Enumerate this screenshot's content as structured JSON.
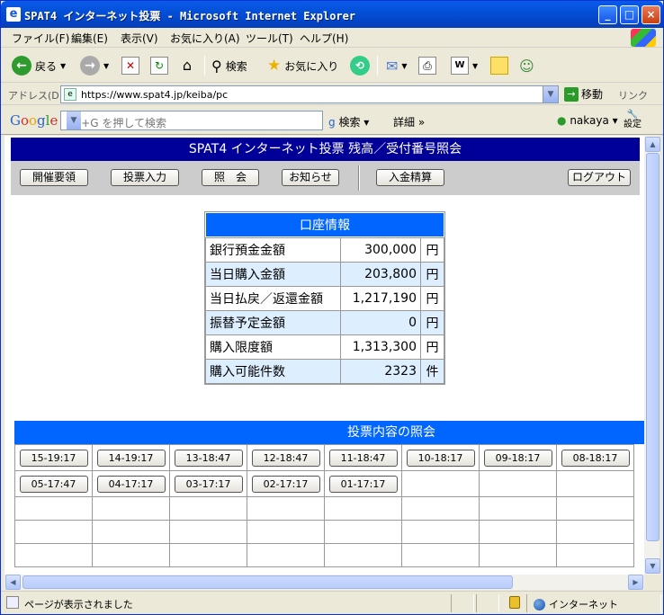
{
  "window": {
    "title": "SPAT4 インターネット投票 - Microsoft Internet Explorer"
  },
  "menu": [
    "ファイル(F)",
    "編集(E)",
    "表示(V)",
    "お気に入り(A)",
    "ツール(T)",
    "ヘルプ(H)"
  ],
  "toolbar": {
    "back": "戻る",
    "search": "検索",
    "favorites": "お気に入り"
  },
  "address": {
    "label": "アドレス(D)",
    "url": "https://www.spat4.jp/keiba/pc",
    "go": "移動",
    "links": "リンク"
  },
  "google": {
    "logo": "Google",
    "placeholder": "Alt+G を押して検索",
    "search": "検索",
    "details": "詳細 »",
    "user": "nakaya",
    "settings": "設定"
  },
  "page": {
    "title": "SPAT4 インターネット投票 残高／受付番号照会",
    "nav": [
      "開催要領",
      "投票入力",
      "照　会",
      "お知らせ",
      "入金精算"
    ],
    "logout": "ログアウト",
    "account": {
      "title": "口座情報",
      "rows": [
        {
          "label": "銀行預金金額",
          "value": "300,000",
          "unit": "円"
        },
        {
          "label": "当日購入金額",
          "value": "203,800",
          "unit": "円"
        },
        {
          "label": "当日払戻／返還金額",
          "value": "1,217,190",
          "unit": "円"
        },
        {
          "label": "振替予定金額",
          "value": "0",
          "unit": "円"
        },
        {
          "label": "購入限度額",
          "value": "1,313,300",
          "unit": "円"
        },
        {
          "label": "購入可能件数",
          "value": "2323",
          "unit": "件"
        }
      ]
    },
    "vote": {
      "title": "投票内容の照会",
      "row1": [
        "15-19:17",
        "14-19:17",
        "13-18:47",
        "12-18:47",
        "11-18:47",
        "10-18:17",
        "09-18:17",
        "08-18:17"
      ],
      "row2": [
        "05-17:47",
        "04-17:17",
        "03-17:17",
        "02-17:17",
        "01-17:17"
      ]
    }
  },
  "status": {
    "text": "ページが表示されました",
    "zone": "インターネット"
  }
}
